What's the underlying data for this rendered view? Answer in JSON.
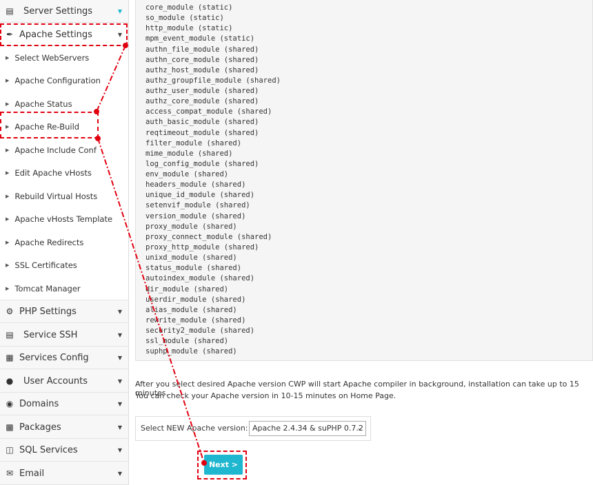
{
  "sidebar": {
    "server_settings": "Server Settings",
    "apache_settings": "Apache Settings",
    "apache_submenu": [
      "Select WebServers",
      "Apache Configuration",
      "Apache Status",
      "Apache Re-Build",
      "Apache Include Conf",
      "Edit Apache vHosts",
      "Rebuild Virtual Hosts",
      "Apache vHosts Template",
      "Apache Redirects",
      "SSL Certificates",
      "Tomcat Manager"
    ],
    "bottom_items": [
      {
        "label": "PHP Settings",
        "icon": "gear-icon"
      },
      {
        "label": "Service SSH",
        "icon": "monitor-icon"
      },
      {
        "label": "Services Config",
        "icon": "list-icon"
      },
      {
        "label": "User Accounts",
        "icon": "user-icon"
      },
      {
        "label": "Domains",
        "icon": "globe-icon"
      },
      {
        "label": "Packages",
        "icon": "package-icon"
      },
      {
        "label": "SQL Services",
        "icon": "database-icon"
      },
      {
        "label": "Email",
        "icon": "envelope-icon"
      }
    ]
  },
  "modules": [
    "core_module (static)",
    "so_module (static)",
    "http_module (static)",
    "mpm_event_module (static)",
    "authn_file_module (shared)",
    "authn_core_module (shared)",
    "authz_host_module (shared)",
    "authz_groupfile_module (shared)",
    "authz_user_module (shared)",
    "authz_core_module (shared)",
    "access_compat_module (shared)",
    "auth_basic_module (shared)",
    "reqtimeout_module (shared)",
    "filter_module (shared)",
    "mime_module (shared)",
    "log_config_module (shared)",
    "env_module (shared)",
    "headers_module (shared)",
    "unique_id_module (shared)",
    "setenvif_module (shared)",
    "version_module (shared)",
    "proxy_module (shared)",
    "proxy_connect_module (shared)",
    "proxy_http_module (shared)",
    "unixd_module (shared)",
    "status_module (shared)",
    "autoindex_module (shared)",
    "dir_module (shared)",
    "userdir_module (shared)",
    "alias_module (shared)",
    "rewrite_module (shared)",
    "security2_module (shared)",
    "ssl_module (shared)",
    "suphp_module (shared)"
  ],
  "info": {
    "line1": "After you select desired Apache version CWP will start Apache compiler in background, installation can take up to 15 minutes.",
    "line2": "You can check your Apache version in 10-15 minutes on Home Page."
  },
  "form": {
    "label": "Select NEW Apache version:",
    "selected": "Apache 2.4.34 & suPHP 0.7.2",
    "next_label": "Next >"
  },
  "colors": {
    "accent": "#1fb6cf",
    "annotation": "#e10010"
  }
}
